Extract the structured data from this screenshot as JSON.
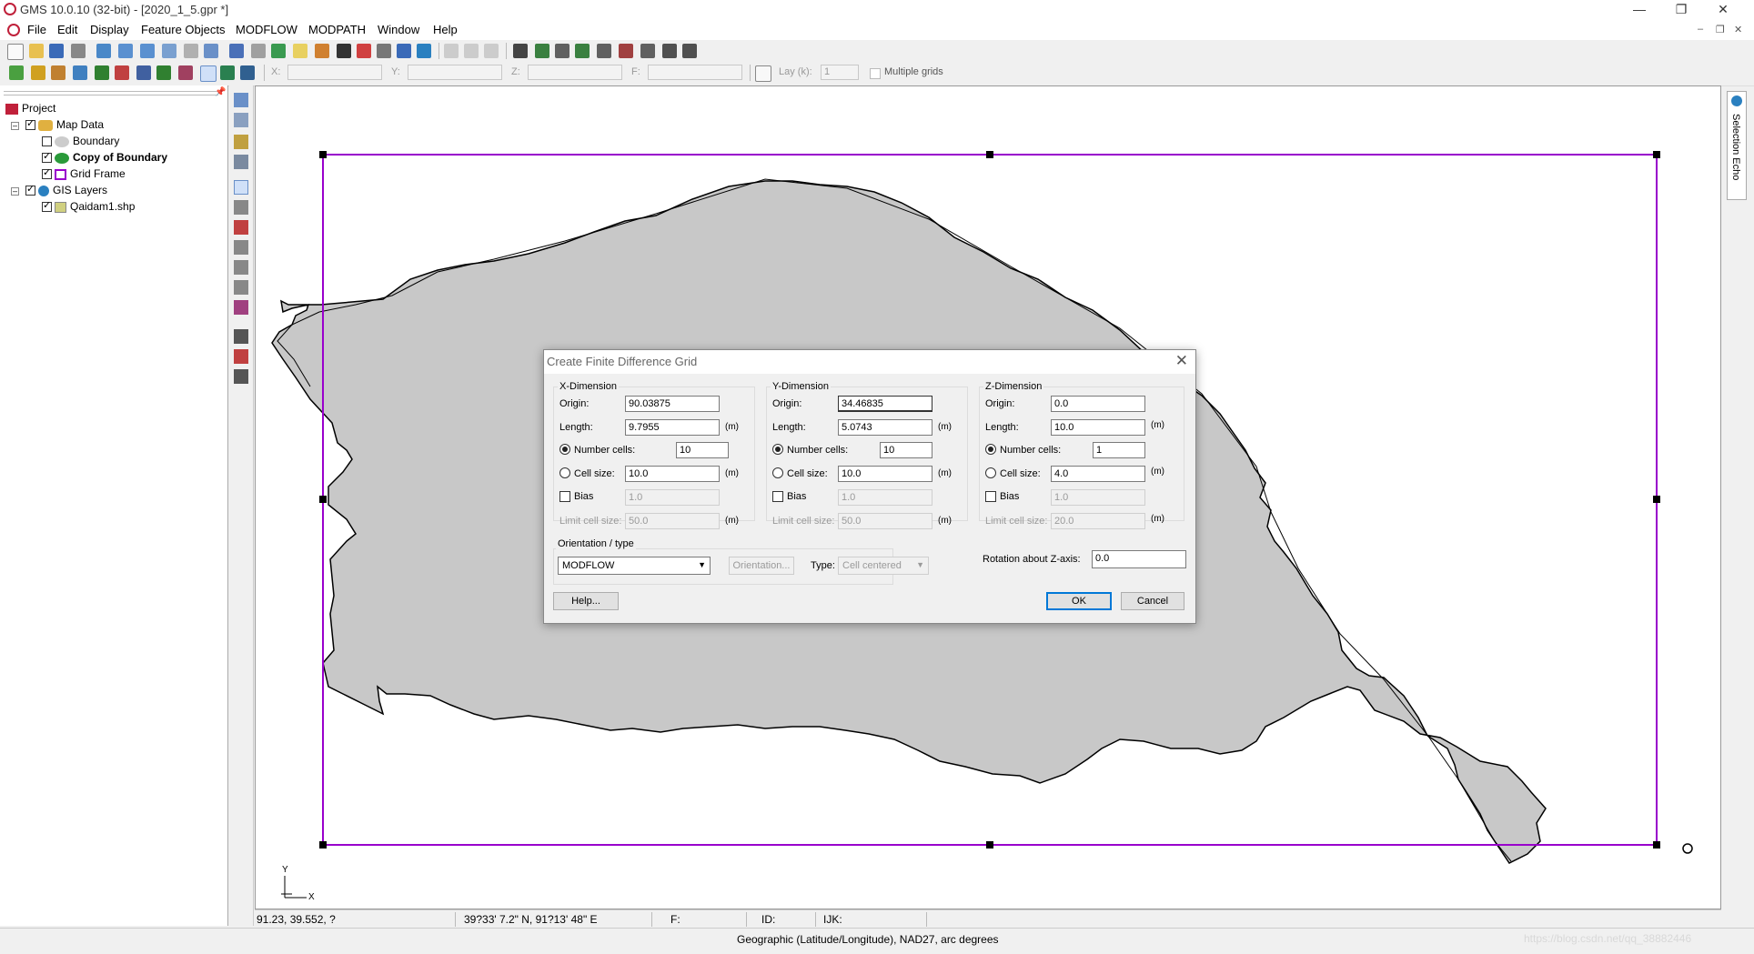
{
  "window": {
    "title": "GMS 10.0.10 (32-bit) - [2020_1_5.gpr *]",
    "minimize_icon": "minimize-icon",
    "restore_icon": "restore-icon",
    "close_icon": "close-icon"
  },
  "menu": {
    "items": [
      "File",
      "Edit",
      "Display",
      "Feature Objects",
      "MODFLOW",
      "MODPATH",
      "Window",
      "Help"
    ]
  },
  "coords_toolbar": {
    "x_label": "X:",
    "y_label": "Y:",
    "z_label": "Z:",
    "f_label": "F:",
    "lay_label": "Lay (k):",
    "lay_value": "1",
    "multiple_grids_label": "Multiple grids"
  },
  "project_tree": {
    "root": "Project",
    "map_data": "Map Data",
    "boundary": "Boundary",
    "copy_of_boundary": "Copy of Boundary",
    "grid_frame": "Grid Frame",
    "gis_layers": "GIS Layers",
    "shapefile": "Qaidam1.shp"
  },
  "side_tab": {
    "label": "Selection Echo"
  },
  "dialog": {
    "title": "Create Finite Difference Grid",
    "x": {
      "group": "X-Dimension",
      "origin_label": "Origin:",
      "origin": "90.03875",
      "length_label": "Length:",
      "length": "9.7955",
      "num_cells_label": "Number cells:",
      "num_cells": "10",
      "cell_size_label": "Cell size:",
      "cell_size": "10.0",
      "bias_label": "Bias",
      "bias": "1.0",
      "limit_label": "Limit cell size:",
      "limit": "50.0"
    },
    "y": {
      "group": "Y-Dimension",
      "origin_label": "Origin:",
      "origin": "34.46835",
      "length_label": "Length:",
      "length": "5.0743",
      "num_cells_label": "Number cells:",
      "num_cells": "10",
      "cell_size_label": "Cell size:",
      "cell_size": "10.0",
      "bias_label": "Bias",
      "bias": "1.0",
      "limit_label": "Limit cell size:",
      "limit": "50.0"
    },
    "z": {
      "group": "Z-Dimension",
      "origin_label": "Origin:",
      "origin": "0.0",
      "length_label": "Length:",
      "length": "10.0",
      "num_cells_label": "Number cells:",
      "num_cells": "1",
      "cell_size_label": "Cell size:",
      "cell_size": "4.0",
      "bias_label": "Bias",
      "bias": "1.0",
      "limit_label": "Limit cell size:",
      "limit": "20.0"
    },
    "unit": "(m)",
    "orientation_group": "Orientation / type",
    "orientation_value": "MODFLOW",
    "orientation_button": "Orientation...",
    "type_label": "Type:",
    "type_value": "Cell centered",
    "rotation_label": "Rotation about Z-axis:",
    "rotation_value": "0.0",
    "help_button": "Help...",
    "ok_button": "OK",
    "cancel_button": "Cancel"
  },
  "axis_indicator": {
    "y": "Y",
    "x": "X"
  },
  "status": {
    "xy": "91.23, 39.552, ?",
    "latlon": "39?33' 7.2\" N, 91?13' 48\" E",
    "f": "F:",
    "id": "ID:",
    "ijk": "IJK:",
    "projection": "Geographic (Latitude/Longitude),  NAD27,  arc degrees",
    "watermark": "https://blog.csdn.net/qq_38882446"
  },
  "colors": {
    "grid_frame": "#9900cc",
    "polygon_fill": "#c8c8c8",
    "app_icon": "#c0203a"
  }
}
